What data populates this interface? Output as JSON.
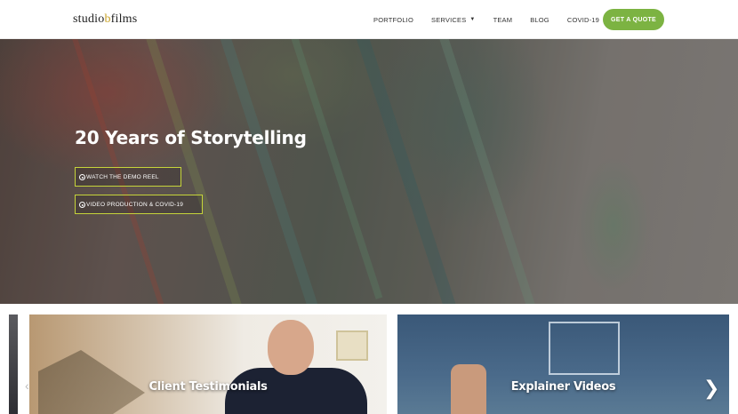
{
  "header": {
    "logo_part1": "studio",
    "logo_part2": "b",
    "logo_part3": "films",
    "nav": [
      {
        "label": "PORTFOLIO"
      },
      {
        "label": "SERVICES"
      },
      {
        "label": "TEAM"
      },
      {
        "label": "BLOG"
      },
      {
        "label": "COVID-19"
      }
    ],
    "cta_label": "GET A QUOTE"
  },
  "hero": {
    "title": "20 Years of Storytelling",
    "button1_label": "WATCH THE DEMO REEL",
    "button2_label": "VIDEO PRODUCTION & COVID-19"
  },
  "carousel": {
    "cards": [
      {
        "label": "Client Testimonials"
      },
      {
        "label": "Explainer Videos"
      }
    ],
    "next_icon": "chevron-right-icon"
  },
  "colors": {
    "accent_green": "#7cb342",
    "button_border": "#c6d43a",
    "logo_b": "#c9a227"
  }
}
